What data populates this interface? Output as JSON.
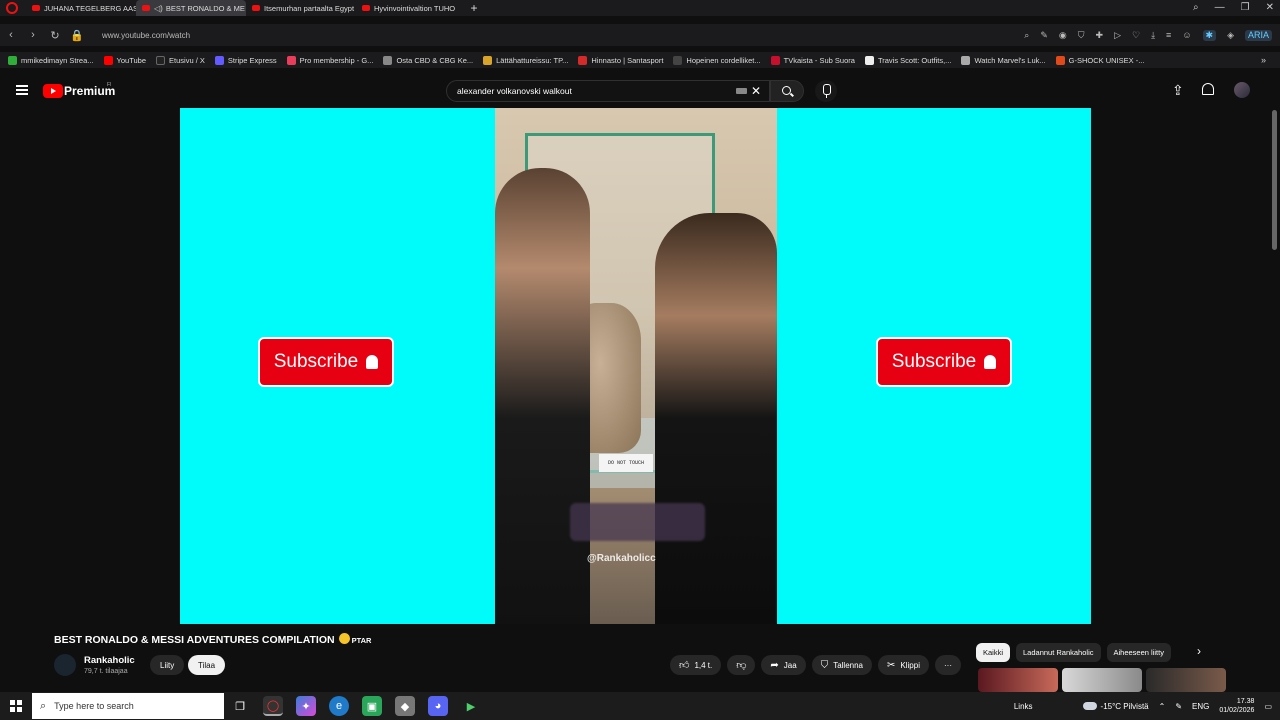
{
  "browser": {
    "tabs": [
      {
        "label": "JUHANA TEGELBERG AASI",
        "active": false,
        "audio": false
      },
      {
        "label": "BEST RONALDO & ME",
        "active": true,
        "audio": true
      },
      {
        "label": "Itsemurhan partaalta Egypt",
        "active": false,
        "audio": false
      },
      {
        "label": "Hyvinvointivaltion TUHO",
        "active": false,
        "audio": false
      }
    ],
    "new_tab": "+",
    "url": "www.youtube.com/watch",
    "aria_label": "ARIA",
    "bookmarks": [
      {
        "label": "mmikedimayn Strea...",
        "color": "#2fae3a"
      },
      {
        "label": "YouTube",
        "color": "#ff0000"
      },
      {
        "label": "Etusivu / X",
        "color": "#222222"
      },
      {
        "label": "Stripe Express",
        "color": "#635bff"
      },
      {
        "label": "Pro membership - G...",
        "color": "#e83e5c"
      },
      {
        "label": "Osta CBD & CBG Ke...",
        "color": "#888888"
      },
      {
        "label": "Lättähattureissu: TP...",
        "color": "#d8a42a"
      },
      {
        "label": "Hinnasto | Santasport",
        "color": "#d42a2a"
      },
      {
        "label": "Hopeinen cordelliket...",
        "color": "#444444"
      },
      {
        "label": "TVkaista - Sub Suora",
        "color": "#c8102e"
      },
      {
        "label": "Travis Scott: Outfits,...",
        "color": "#eeeeee"
      },
      {
        "label": "Watch Marvel's Luk...",
        "color": "#aaaaaa"
      },
      {
        "label": "G-SHOCK UNISEX -...",
        "color": "#e04a1a"
      }
    ],
    "bookmarks_more": "»"
  },
  "youtube": {
    "logo_text": "Premium",
    "region": "FI",
    "search": {
      "value": "alexander volkanovski walkout"
    },
    "video": {
      "subscribe_label": "Subscribe",
      "watermark": "@Rankaholicc",
      "sign_text": "DO NOT TOUCH",
      "background_color": "#00fbfb"
    },
    "title": {
      "text": "BEST RONALDO & MESSI ADVENTURES COMPILATION",
      "suffix": "PTAR"
    },
    "channel": {
      "name": "Rankaholic",
      "subs": "79,7 t. tilaajaa"
    },
    "join_label": "Liity",
    "subscribe_button": "Tilaa",
    "actions": {
      "like_count": "1,4 t.",
      "share": "Jaa",
      "save": "Tallenna",
      "clip": "Klippi",
      "more": "···"
    },
    "chips": [
      "Kaikki",
      "Ladannut Rankaholic",
      "Aiheeseen liitty"
    ]
  },
  "taskbar": {
    "search_placeholder": "Type here to search",
    "links": "Links",
    "weather": "-15°C  Pilvistä",
    "lang": "ENG",
    "time": "17.38",
    "date": "01/02/2026"
  }
}
